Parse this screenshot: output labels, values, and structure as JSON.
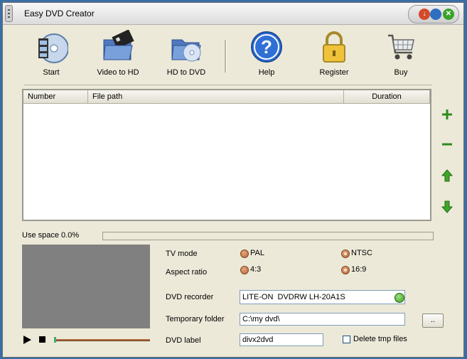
{
  "window": {
    "title": "Easy DVD Creator"
  },
  "toolbar": {
    "items": [
      {
        "label": "Start",
        "icon": "film-disc-icon"
      },
      {
        "label": "Video to HD",
        "icon": "video-folder-icon"
      },
      {
        "label": "HD to DVD",
        "icon": "disc-folder-icon"
      },
      {
        "label": "Help",
        "icon": "help-icon"
      },
      {
        "label": "Register",
        "icon": "lock-icon"
      },
      {
        "label": "Buy",
        "icon": "cart-icon"
      }
    ]
  },
  "filelist": {
    "columns": [
      "Number",
      "File path",
      "Duration"
    ],
    "rows": []
  },
  "side_buttons": [
    "add-icon",
    "remove-icon",
    "move-up-icon",
    "move-down-icon"
  ],
  "usage": {
    "label": "Use space 0.0%",
    "percent": 0
  },
  "settings": {
    "tv_mode": {
      "label": "TV mode",
      "options": [
        "PAL",
        "NTSC"
      ],
      "selected": "NTSC"
    },
    "aspect_ratio": {
      "label": "Aspect ratio",
      "options": [
        "4:3",
        "16:9"
      ],
      "selected": "16:9"
    },
    "dvd_recorder": {
      "label": "DVD recorder",
      "value": "LITE-ON  DVDRW LH-20A1S"
    },
    "temp_folder": {
      "label": "Temporary folder",
      "value": "C:\\my dvd\\",
      "browse_label": ".."
    },
    "dvd_label": {
      "label": "DVD label",
      "value": "divx2dvd"
    },
    "delete_tmp": {
      "label": "Delete tmp files",
      "checked": false
    }
  },
  "colors": {
    "window_bg": "#ece9d8",
    "desktop": "#3a6ea5",
    "accent_green": "#3c9a22"
  }
}
